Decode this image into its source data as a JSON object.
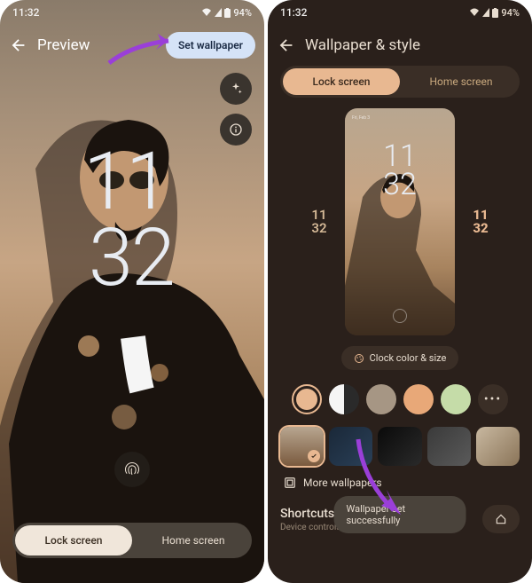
{
  "left": {
    "status": {
      "time": "11:32",
      "battery": "94%"
    },
    "header": {
      "title": "Preview",
      "set_button": "Set wallpaper"
    },
    "clock": {
      "line1": "11",
      "line2": "32"
    },
    "tabs": {
      "lock": "Lock screen",
      "home": "Home screen"
    }
  },
  "right": {
    "status": {
      "time": "11:32",
      "battery": "94%"
    },
    "header": {
      "title": "Wallpaper & style"
    },
    "segments": {
      "lock": "Lock screen",
      "home": "Home screen"
    },
    "preview": {
      "line1": "11",
      "line2": "32",
      "top_time": "Fri, Feb 3"
    },
    "clock_styles": {
      "a": "11\n32",
      "b": "11\n32"
    },
    "clock_color_btn": "Clock color & size",
    "swatches": {
      "c1": "#e8b891",
      "c3": "#a69684",
      "c4": "#e8a878",
      "c5": "#c5dca8"
    },
    "more_wallpapers": "More wallpapers",
    "shortcuts": {
      "title": "Shortcuts",
      "sub": "Device controls"
    },
    "toast": "Wallpaper set successfully"
  }
}
